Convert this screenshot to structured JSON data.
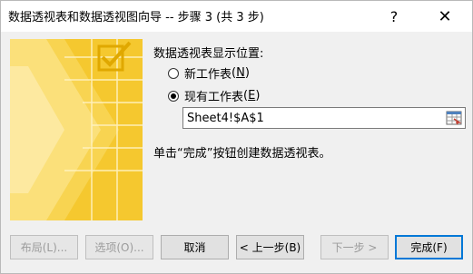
{
  "window": {
    "title": "数据透视表和数据透视图向导 -- 步骤 3 (共 3 步)",
    "help_glyph": "?",
    "close_glyph": "✕"
  },
  "colors": {
    "wizard_yellow": "#f5c82f",
    "accent_blue": "#0078d7"
  },
  "location": {
    "heading": "数据透视表显示位置:",
    "options": [
      {
        "label": "新工作表",
        "hotkey": "N",
        "selected": false
      },
      {
        "label": "现有工作表",
        "hotkey": "E",
        "selected": true
      }
    ],
    "range_value": "Sheet4!$A$1",
    "range_button_icon": "range-select-icon"
  },
  "hint": "单击“完成”按钮创建数据透视表。",
  "buttons": {
    "layout": "布局(L)...",
    "options": "选项(O)...",
    "cancel": "取消",
    "back": "< 上一步(B)",
    "next": "下一步 >",
    "finish": "完成(F)"
  }
}
